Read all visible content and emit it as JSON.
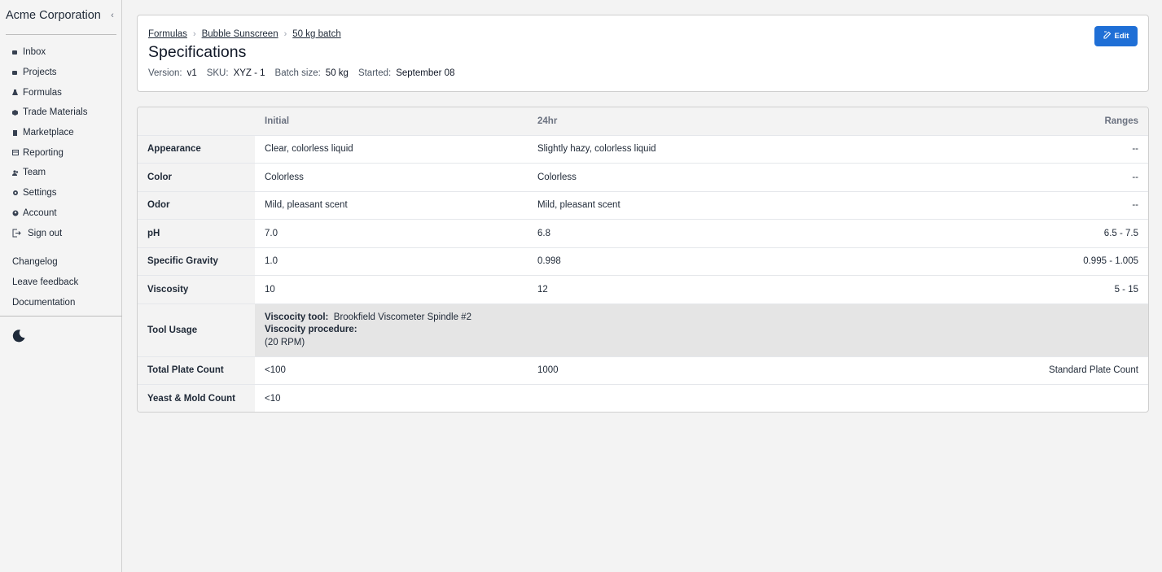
{
  "sidebar": {
    "org_name": "Acme Corporation",
    "collapse_icon": "chevron-left-icon",
    "nav": [
      {
        "label": "Inbox",
        "icon": "inbox-icon"
      },
      {
        "label": "Projects",
        "icon": "folder-icon"
      },
      {
        "label": "Formulas",
        "icon": "flask-icon"
      },
      {
        "label": "Trade Materials",
        "icon": "cube-icon"
      },
      {
        "label": "Marketplace",
        "icon": "store-icon"
      },
      {
        "label": "Reporting",
        "icon": "table-icon"
      },
      {
        "label": "Team",
        "icon": "users-icon"
      },
      {
        "label": "Settings",
        "icon": "gear-icon"
      },
      {
        "label": "Account",
        "icon": "user-circle-icon"
      }
    ],
    "sign_out": "Sign out",
    "links": [
      "Changelog",
      "Leave feedback",
      "Documentation"
    ],
    "theme_icon": "moon-icon"
  },
  "header": {
    "breadcrumbs": [
      "Formulas",
      "Bubble Sunscreen",
      "50 kg batch"
    ],
    "title": "Specifications",
    "meta": {
      "version_label": "Version:",
      "version": "v1",
      "sku_label": "SKU:",
      "sku": "XYZ - 1",
      "batch_label": "Batch size:",
      "batch": "50 kg",
      "started_label": "Started:",
      "started": "September 08"
    },
    "edit_label": "Edit",
    "accent": "#1f6fd6"
  },
  "table": {
    "columns": [
      "Initial",
      "24hr",
      "Ranges"
    ],
    "rows": [
      {
        "label": "Appearance",
        "initial": "Clear, colorless liquid",
        "h24": "Slightly hazy, colorless liquid",
        "range": "--"
      },
      {
        "label": "Color",
        "initial": "Colorless",
        "h24": "Colorless",
        "range": "--"
      },
      {
        "label": "Odor",
        "initial": "Mild, pleasant scent",
        "h24": "Mild, pleasant scent",
        "range": "--"
      },
      {
        "label": "pH",
        "initial": "7.0",
        "h24": "6.8",
        "range": "6.5 - 7.5"
      },
      {
        "label": "Specific Gravity",
        "initial": "1.0",
        "h24": "0.998",
        "range": "0.995 - 1.005"
      },
      {
        "label": "Viscosity",
        "initial": "10",
        "h24": "12",
        "range": "5 - 15"
      }
    ],
    "tool_usage": {
      "label": "Tool Usage",
      "tool_label": "Viscocity tool:",
      "tool_value": "Brookfield Viscometer Spindle #2",
      "procedure_label": "Viscocity procedure:",
      "procedure_value": "(20 RPM)"
    },
    "rows_after": [
      {
        "label": "Total Plate Count",
        "initial": "<100",
        "h24": "1000",
        "range": "Standard Plate Count"
      },
      {
        "label": "Yeast & Mold Count",
        "initial": "<10",
        "h24": "",
        "range": ""
      }
    ]
  }
}
